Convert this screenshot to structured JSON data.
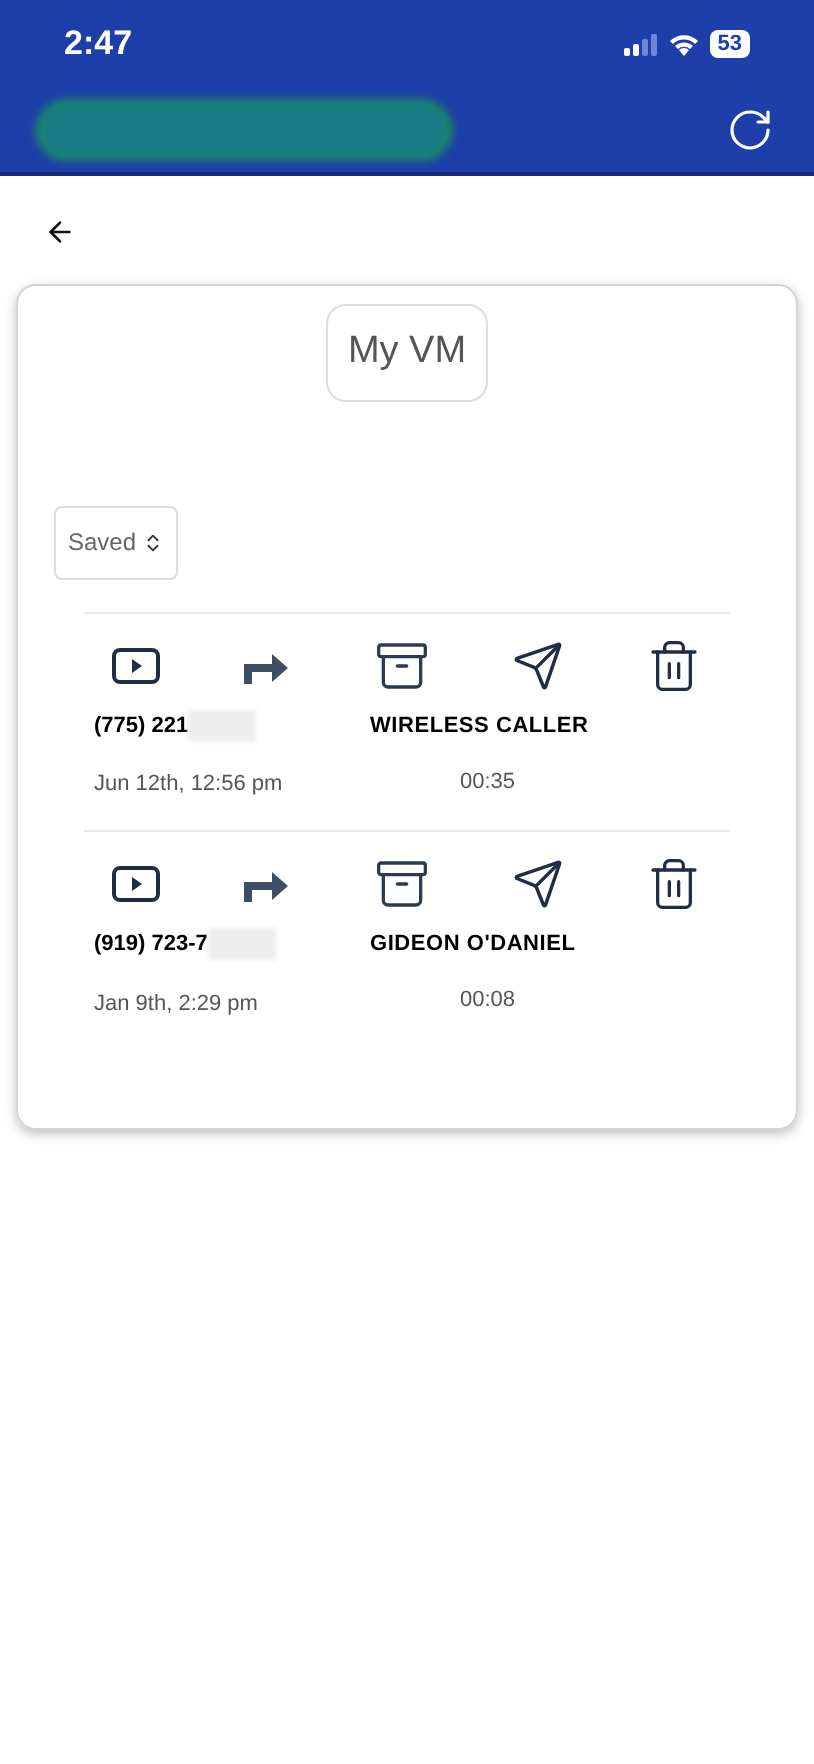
{
  "status_bar": {
    "time": "2:47",
    "battery": "53"
  },
  "page": {
    "title": "My VM",
    "filter": "Saved"
  },
  "voicemails": [
    {
      "number": "(775) 221",
      "name": "WIRELESS CALLER",
      "date": "Jun 12th, 12:56 pm",
      "duration": "00:35"
    },
    {
      "number": "(919) 723-7",
      "name": "GIDEON O'DANIEL",
      "date": "Jan 9th, 2:29 pm",
      "duration": "00:08"
    }
  ]
}
